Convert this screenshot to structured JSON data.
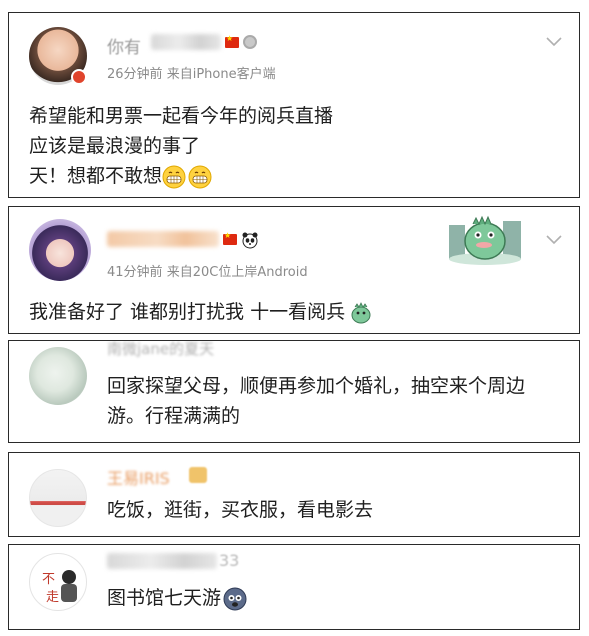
{
  "comments": [
    {
      "name_visible": "你有",
      "meta_time": "26分钟前",
      "meta_via_prefix": "来自",
      "meta_via": "iPhone客户端",
      "lines": [
        "希望能和男票一起看今年的阅兵直播",
        "应该是最浪漫的事了",
        "天！想都不敢想"
      ]
    },
    {
      "meta_time": "41分钟前",
      "meta_via_prefix": "来自",
      "meta_via": "20C位上岸Android",
      "lines": [
        "我准备好了   谁都别打扰我   十一看阅兵"
      ]
    },
    {
      "name_visible": "南微jane的夏天",
      "lines": [
        "回家探望父母，顺便再参加个婚礼，抽空来个周边",
        "游。行程满满的"
      ]
    },
    {
      "name_visible": "王易IRIS",
      "lines": [
        "吃饭，逛街，买衣服，看电影去"
      ]
    },
    {
      "name_visible": "33",
      "avatar_text": [
        "不",
        "走"
      ],
      "lines": [
        "图书馆七天游"
      ]
    }
  ],
  "icons": {
    "expand": "chevron-down-icon",
    "flag": "china-flag-icon",
    "grin": "grinning-face-icon",
    "panda": "panda-icon",
    "dino": "dinosaur-sticker-icon"
  },
  "colors": {
    "text": "#1f1f1f",
    "meta": "#8a8a8a",
    "via": "#5b7fb0",
    "flag": "#de2910"
  }
}
